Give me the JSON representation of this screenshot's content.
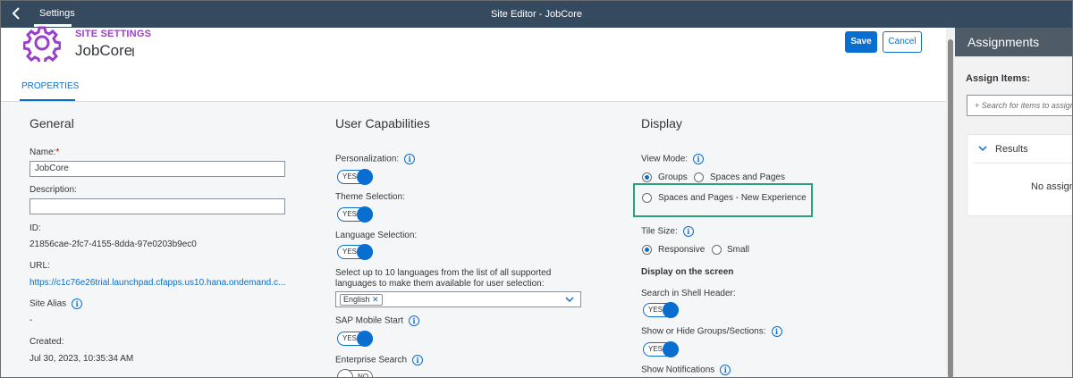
{
  "shell": {
    "back_icon": "back-arrow-icon",
    "tab": "Settings",
    "title": "Site Editor - JobCore"
  },
  "header": {
    "section": "SITE SETTINGS",
    "site_name": "JobCore",
    "save": "Save",
    "cancel": "Cancel",
    "tab": "PROPERTIES"
  },
  "general": {
    "title": "General",
    "name_label": "Name:",
    "name_required": "*",
    "name_value": "JobCore",
    "description_label": "Description:",
    "description_value": "",
    "id_label": "ID:",
    "id_value": "21856cae-2fc7-4155-8dda-97e0203b9ec0",
    "url_label": "URL:",
    "url_value": "https://c1c76e26trial.launchpad.cfapps.us10.hana.ondemand.c...",
    "alias_label": "Site Alias",
    "alias_value": "-",
    "created_label": "Created:",
    "created_value": "Jul 30, 2023, 10:35:34 AM"
  },
  "user_capabilities": {
    "title": "User Capabilities",
    "personalization": "Personalization:",
    "theme_selection": "Theme Selection:",
    "language_selection": "Language Selection:",
    "languages_help": "Select up to 10 languages from the list of all supported languages to make them available for user selection:",
    "language_token": "English",
    "sap_mobile_start": "SAP Mobile Start",
    "enterprise_search": "Enterprise Search",
    "yes": "YES",
    "no": "NO"
  },
  "display": {
    "title": "Display",
    "view_mode": "View Mode:",
    "groups": "Groups",
    "spaces_pages": "Spaces and Pages",
    "spaces_pages_new": "Spaces and Pages - New Experience",
    "tile_size": "Tile Size:",
    "responsive": "Responsive",
    "small": "Small",
    "display_on_screen": "Display on the screen",
    "search_shell": "Search in Shell Header:",
    "show_hide": "Show or Hide Groups/Sections:",
    "show_notifications": "Show Notifications",
    "yes": "YES"
  },
  "assignments": {
    "title": "Assignments",
    "assign_items": "Assign Items:",
    "search_placeholder": "+ Search for items to assign",
    "results": "Results",
    "no_assign": "No assignments"
  },
  "colors": {
    "shell": "#354a5f",
    "accent": "#0a6ed1",
    "section": "#9b3fc9",
    "highlight": "#2e9f7c"
  }
}
